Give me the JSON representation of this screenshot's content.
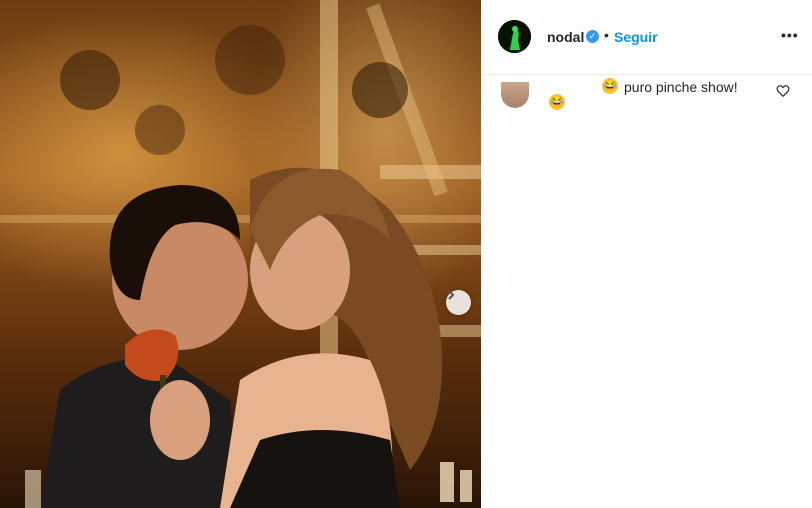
{
  "post": {
    "username": "nodal",
    "separator": "•",
    "follow_label": "Seguir",
    "more_icon": "more-options-icon",
    "verified_icon": "verified-badge-icon"
  },
  "comments": [
    {
      "text": "😂",
      "emoji": "laughing-emoji"
    },
    {
      "emoji_prefix": "😂",
      "text": "puro pinche show!"
    }
  ],
  "colors": {
    "accent": "#0095f6",
    "verified": "#3897f0",
    "text": "#262626"
  }
}
